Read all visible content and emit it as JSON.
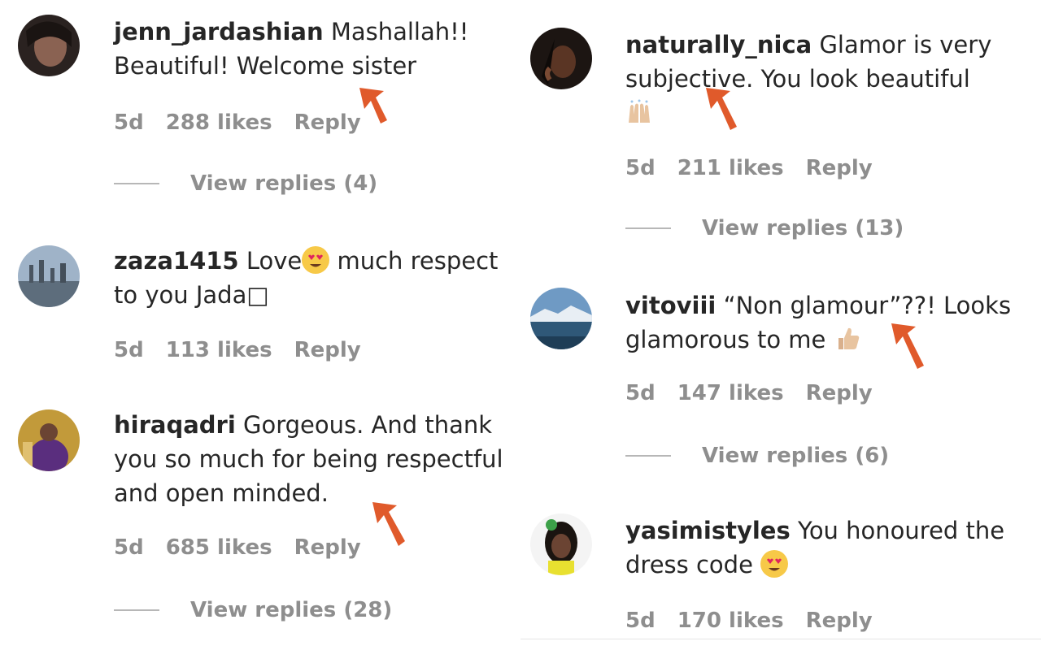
{
  "left": [
    {
      "username": "jenn_jardashian",
      "text": "Mashallah!! Beautiful! Welcome sister",
      "age": "5d",
      "likes": "288 likes",
      "reply": "Reply",
      "view_replies": "View replies (4)"
    },
    {
      "username": "zaza1415",
      "text_a": "Love",
      "text_b": "much respect to you Jada□",
      "age": "5d",
      "likes": "113 likes",
      "reply": "Reply"
    },
    {
      "username": "hiraqadri",
      "text": "Gorgeous. And thank you so much for being respectful and open minded.",
      "age": "5d",
      "likes": "685 likes",
      "reply": "Reply",
      "view_replies": "View replies (28)"
    }
  ],
  "right": [
    {
      "username": "naturally_nica",
      "text": "Glamor is very subjective. You look beautiful",
      "age": "5d",
      "likes": "211 likes",
      "reply": "Reply",
      "view_replies": "View replies (13)"
    },
    {
      "username": "vitoviii",
      "text": "“Non glamour”??! Looks glamorous to me",
      "age": "5d",
      "likes": "147 likes",
      "reply": "Reply",
      "view_replies": "View replies (6)"
    },
    {
      "username": "yasimistyles",
      "text": "You honoured the dress code",
      "age": "5d",
      "likes": "170 likes",
      "reply": "Reply"
    }
  ],
  "colors": {
    "arrow": "#e05a2b",
    "meta": "#8e8e8e",
    "text": "#262626"
  },
  "icons": [
    "heart-eyes-emoji",
    "raised-hands-emoji",
    "thumbs-up-emoji",
    "pointer-arrow"
  ]
}
